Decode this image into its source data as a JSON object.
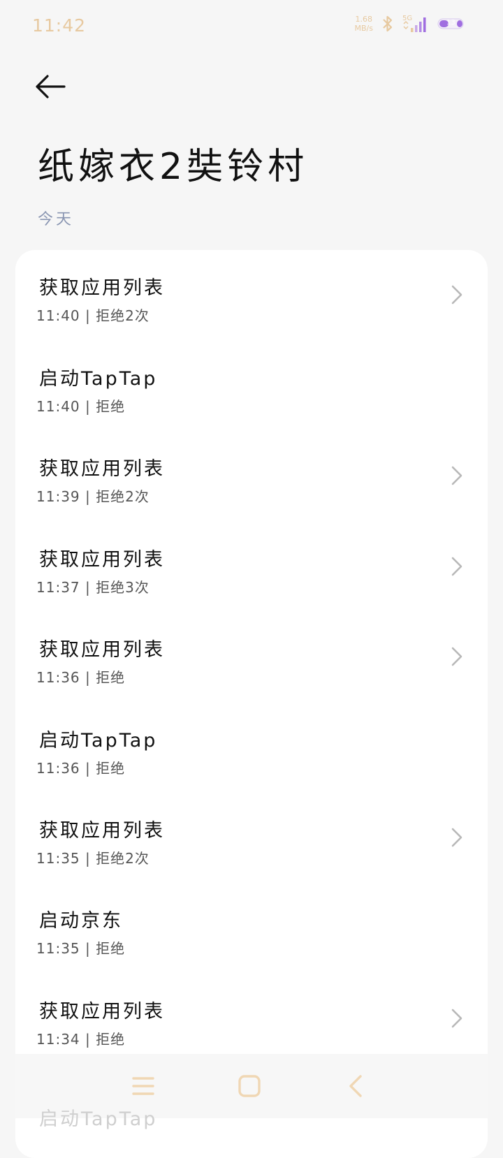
{
  "status_bar": {
    "time": "11:42",
    "net_speed_value": "1.68",
    "net_speed_unit": "MB/s",
    "network_type": "5G",
    "battery_level": "13",
    "accent_color": "#e7c9a0",
    "battery_color": "#a06ee0"
  },
  "header": {
    "back_icon": "arrow-left-icon",
    "title": "纸嫁衣2奘铃村"
  },
  "section": {
    "label": "今天"
  },
  "records": [
    {
      "title": "获取应用列表",
      "time": "11:40",
      "separator": "|",
      "status": "拒绝2次",
      "has_chevron": true
    },
    {
      "title": "启动TapTap",
      "time": "11:40",
      "separator": "|",
      "status": "拒绝",
      "has_chevron": false
    },
    {
      "title": "获取应用列表",
      "time": "11:39",
      "separator": "|",
      "status": "拒绝2次",
      "has_chevron": true
    },
    {
      "title": "获取应用列表",
      "time": "11:37",
      "separator": "|",
      "status": "拒绝3次",
      "has_chevron": true
    },
    {
      "title": "获取应用列表",
      "time": "11:36",
      "separator": "|",
      "status": "拒绝",
      "has_chevron": true
    },
    {
      "title": "启动TapTap",
      "time": "11:36",
      "separator": "|",
      "status": "拒绝",
      "has_chevron": false
    },
    {
      "title": "获取应用列表",
      "time": "11:35",
      "separator": "|",
      "status": "拒绝2次",
      "has_chevron": true
    },
    {
      "title": "启动京东",
      "time": "11:35",
      "separator": "|",
      "status": "拒绝",
      "has_chevron": false
    },
    {
      "title": "获取应用列表",
      "time": "11:34",
      "separator": "|",
      "status": "拒绝",
      "has_chevron": true
    }
  ],
  "partial_next_item": {
    "title": "启动TapTap"
  },
  "nav_bar": {
    "menu_icon": "menu-icon",
    "home_icon": "home-square-icon",
    "back_icon": "back-chevron-icon",
    "icon_color": "#f0d7b4"
  }
}
